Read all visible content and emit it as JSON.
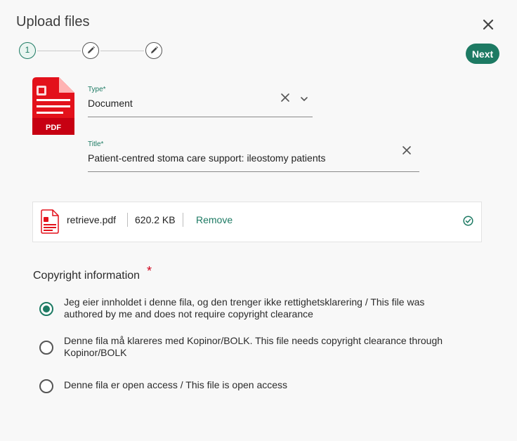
{
  "dialog": {
    "title": "Upload files",
    "close_icon": "close-icon",
    "next_label": "Next",
    "accent_color": "#1d7a63"
  },
  "stepper": {
    "current_step": "1",
    "steps": [
      {
        "label": "1",
        "state": "active"
      },
      {
        "icon": "pencil-icon",
        "state": "pending"
      },
      {
        "icon": "pencil-icon",
        "state": "pending"
      }
    ]
  },
  "document_icon": {
    "icon": "pdf-file-icon",
    "badge": "PDF",
    "color": "#e3111b"
  },
  "form": {
    "type_label": "Type*",
    "type_value": "Document",
    "title_label": "Title*",
    "title_value": "Patient-centred stoma care support: ileostomy patients"
  },
  "file": {
    "name": "retrieve.pdf",
    "size": "620.2 KB",
    "remove_label": "Remove",
    "status_icon": "check-circle-icon"
  },
  "copyright": {
    "title": "Copyright information",
    "required_mark": "*",
    "options": [
      {
        "label": "Jeg eier innholdet i denne fila, og den trenger ikke rettighetsklarering / This file was authored by me and does not require copyright clearance",
        "selected": true
      },
      {
        "label": "Denne fila må klareres med Kopinor/BOLK. This file needs copyright clearance through Kopinor/BOLK",
        "selected": false
      },
      {
        "label": "Denne fila er open access / This file is open access",
        "selected": false
      }
    ]
  }
}
